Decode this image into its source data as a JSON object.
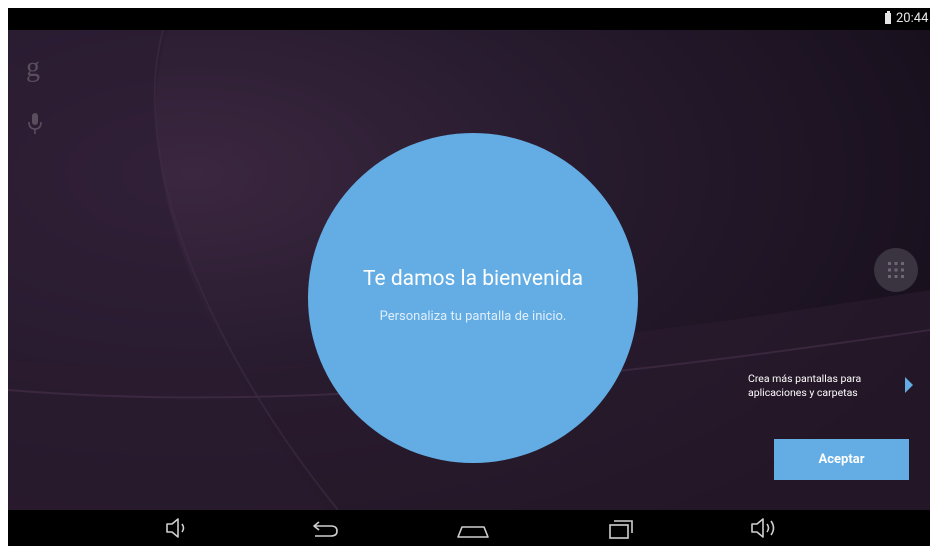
{
  "status_bar": {
    "time": "20:44",
    "battery_icon": "battery-icon"
  },
  "left_dock": {
    "google_logo_glyph": "g",
    "icons": [
      "google-search-icon",
      "microphone-icon"
    ]
  },
  "welcome": {
    "title": "Te damos la bienvenida",
    "subtitle": "Personaliza tu pantalla de inicio."
  },
  "apps_button": {
    "icon": "app-drawer-icon"
  },
  "hint": {
    "line1": "Crea más pantallas para",
    "line2": "aplicaciones y carpetas"
  },
  "accept_button": {
    "label": "Aceptar"
  },
  "nav_bar": {
    "icons": [
      "volume-down-icon",
      "back-icon",
      "home-icon",
      "recent-apps-icon",
      "volume-up-icon"
    ]
  },
  "colors": {
    "accent": "#63ade4",
    "background": "#1a1220",
    "bar": "#000000"
  }
}
